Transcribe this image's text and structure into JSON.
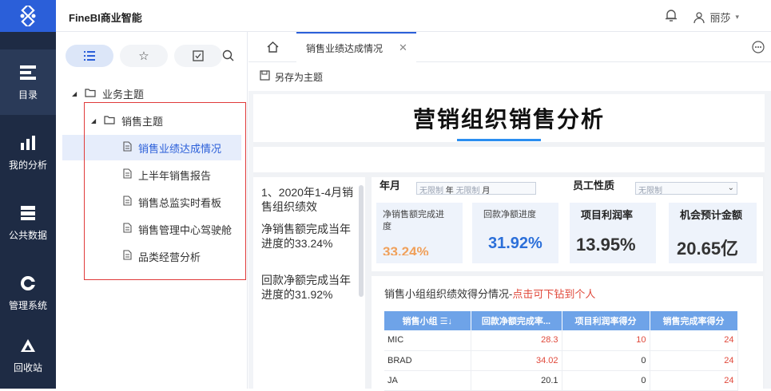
{
  "app": {
    "title": "FineBI商业智能",
    "user": "丽莎"
  },
  "nav": [
    {
      "label": "目录",
      "icon": "catalog-icon"
    },
    {
      "label": "我的分析",
      "icon": "analysis-icon"
    },
    {
      "label": "公共数据",
      "icon": "database-icon"
    },
    {
      "label": "管理系统",
      "icon": "gear-icon"
    },
    {
      "label": "回收站",
      "icon": "recycle-icon"
    }
  ],
  "tree": {
    "root": "业务主题",
    "folder": "销售主题",
    "items": [
      "销售业绩达成情况",
      "上半年销售报告",
      "销售总监实时看板",
      "销售管理中心驾驶舱",
      "品类经营分析"
    ]
  },
  "tabs": {
    "active": "销售业绩达成情况"
  },
  "toolbar": {
    "save_as": "另存为主题"
  },
  "dashboard": {
    "title": "营销组织销售分析",
    "text_blocks": [
      "1、2020年1-4月销售组织绩效",
      "净销售额完成当年进度的33.24%",
      "回款净额完成当年进度的31.92%"
    ],
    "filters": [
      {
        "label": "年月",
        "value1": "无限制",
        "unit1": "年",
        "value2": "无限制",
        "unit2": "月"
      },
      {
        "label": "员工性质",
        "value": "无限制"
      }
    ],
    "kpis": [
      {
        "label": "净销售额完成进度",
        "value": "33.24%"
      },
      {
        "label": "回款净额进度",
        "value": "31.92%"
      },
      {
        "label": "项目利润率",
        "value": "13.95%"
      },
      {
        "label": "机会预计金额",
        "value": "20.65亿"
      }
    ],
    "table": {
      "title": "销售小组组织绩效得分情况-",
      "title_hint": "点击可下钻到个人",
      "headers": [
        "销售小组",
        "回款净额完成率...",
        "项目利润率得分",
        "销售完成率得分"
      ],
      "rows": [
        [
          "MIC",
          "28.3",
          "10",
          "24"
        ],
        [
          "BRAD",
          "34.02",
          "0",
          "24"
        ],
        [
          "JA",
          "20.1",
          "0",
          "24"
        ]
      ]
    }
  }
}
